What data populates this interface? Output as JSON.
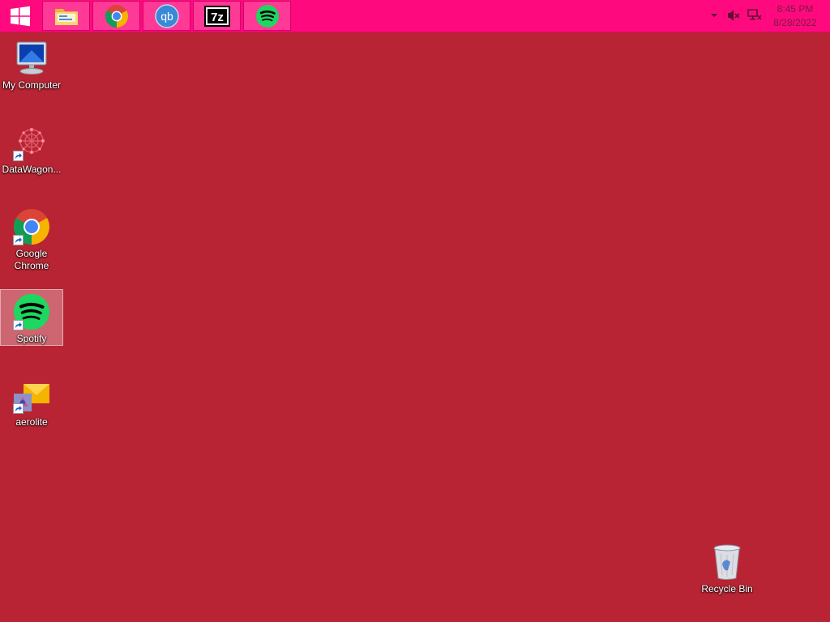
{
  "taskbar": {
    "start_icon": "windows-logo-icon",
    "pinned": [
      {
        "name": "file-explorer",
        "icon": "folder-icon"
      },
      {
        "name": "google-chrome",
        "icon": "chrome-icon"
      },
      {
        "name": "qbittorrent",
        "icon": "qbittorrent-icon",
        "text": "qb"
      },
      {
        "name": "7-zip",
        "icon": "7zip-icon",
        "text": "7z"
      },
      {
        "name": "spotify",
        "icon": "spotify-icon"
      }
    ],
    "tray": {
      "time": "8:45 PM",
      "date": "8/28/2022"
    }
  },
  "desktop": {
    "icons": [
      {
        "label": "My Computer",
        "icon": "computer-icon"
      },
      {
        "label": "DataWagon...",
        "icon": "datawagon-icon",
        "shortcut": true
      },
      {
        "label": "Google Chrome",
        "icon": "chrome-icon",
        "shortcut": true
      },
      {
        "label": "Spotify",
        "icon": "spotify-icon",
        "shortcut": true,
        "selected": true
      },
      {
        "label": "aerolite",
        "icon": "aerolite-icon",
        "shortcut": true
      },
      {
        "label": "Recycle Bin",
        "icon": "recycle-bin-icon"
      }
    ]
  },
  "colors": {
    "desktop_background": "#b82433",
    "taskbar": "#ff0a7e",
    "spotify_green": "#1ed760"
  }
}
